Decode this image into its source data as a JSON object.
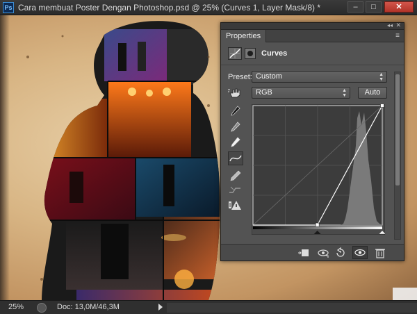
{
  "window": {
    "app_logo_text": "Ps",
    "title": "Cara membuat Poster Dengan Photoshop.psd @ 25% (Curves 1, Layer Mask/8) *",
    "minimize_glyph": "–",
    "maximize_glyph": "□",
    "close_glyph": "✕"
  },
  "properties_panel": {
    "collapse_glyph": "◂◂",
    "close_glyph": "✕",
    "tab_label": "Properties",
    "menu_glyph": "≡",
    "adjustment_title": "Curves",
    "preset_label": "Preset:",
    "preset_value": "Custom",
    "channel_value": "RGB",
    "auto_label": "Auto",
    "icons": [
      "curves-adjustment-icon",
      "layer-mask-icon",
      "on-image-adjust-icon",
      "sample-black-eyedropper-icon",
      "sample-gray-eyedropper-icon",
      "sample-white-eyedropper-icon",
      "edit-points-curve-icon",
      "draw-pencil-icon",
      "smooth-curve-icon",
      "clipping-warning-icon",
      "clip-to-layer-icon",
      "view-previous-icon",
      "reset-icon",
      "visibility-eye-icon",
      "trash-icon"
    ],
    "curve": {
      "input_black_point": 127,
      "input_white_point": 255,
      "highlight_color": "#ffffff"
    }
  },
  "status_bar": {
    "zoom": "25%",
    "doc_size": "Doc: 13,0M/46,3M"
  },
  "colors": {
    "panel_bg": "#535353",
    "close_button": "#c7463b",
    "paper": "#d8b584"
  }
}
